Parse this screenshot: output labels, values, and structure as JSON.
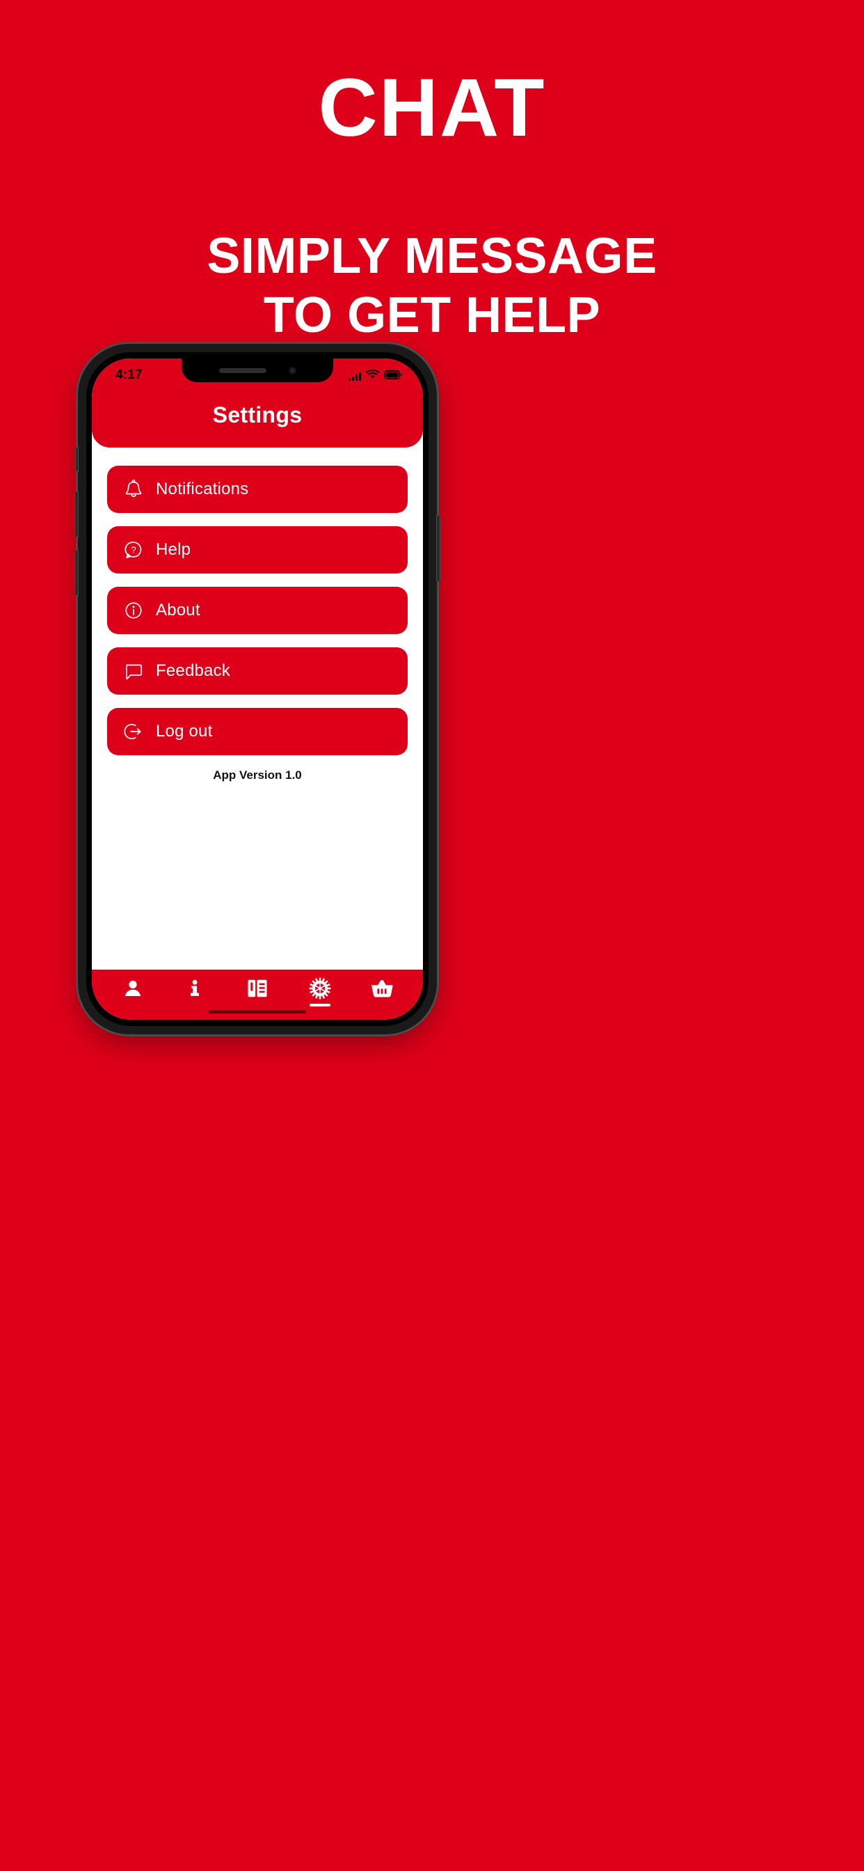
{
  "promo": {
    "title": "CHAT",
    "subtitle_line1": "SIMPLY MESSAGE",
    "subtitle_line2": "TO GET HELP"
  },
  "colors": {
    "brand_red": "#DE0019",
    "white": "#FFFFFF",
    "phone_frame": "#1A1A1A"
  },
  "phone": {
    "status_bar": {
      "time": "4:17",
      "signal_icon": "cellular-signal-icon",
      "wifi_icon": "wifi-icon",
      "battery_icon": "battery-icon"
    },
    "app": {
      "header_title": "Settings",
      "menu_items": [
        {
          "label": "Notifications",
          "icon": "bell-icon"
        },
        {
          "label": "Help",
          "icon": "question-bubble-icon"
        },
        {
          "label": "About",
          "icon": "info-circle-icon"
        },
        {
          "label": "Feedback",
          "icon": "chat-bubble-icon"
        },
        {
          "label": "Log out",
          "icon": "logout-arrow-icon"
        }
      ],
      "version_text": "App Version 1.0",
      "tabs": [
        {
          "name": "profile",
          "icon": "person-icon",
          "active": false
        },
        {
          "name": "info",
          "icon": "info-i-icon",
          "active": false
        },
        {
          "name": "menu",
          "icon": "menu-book-icon",
          "active": false
        },
        {
          "name": "settings",
          "icon": "gear-icon",
          "active": true
        },
        {
          "name": "basket",
          "icon": "shopping-basket-icon",
          "active": false
        }
      ]
    }
  }
}
